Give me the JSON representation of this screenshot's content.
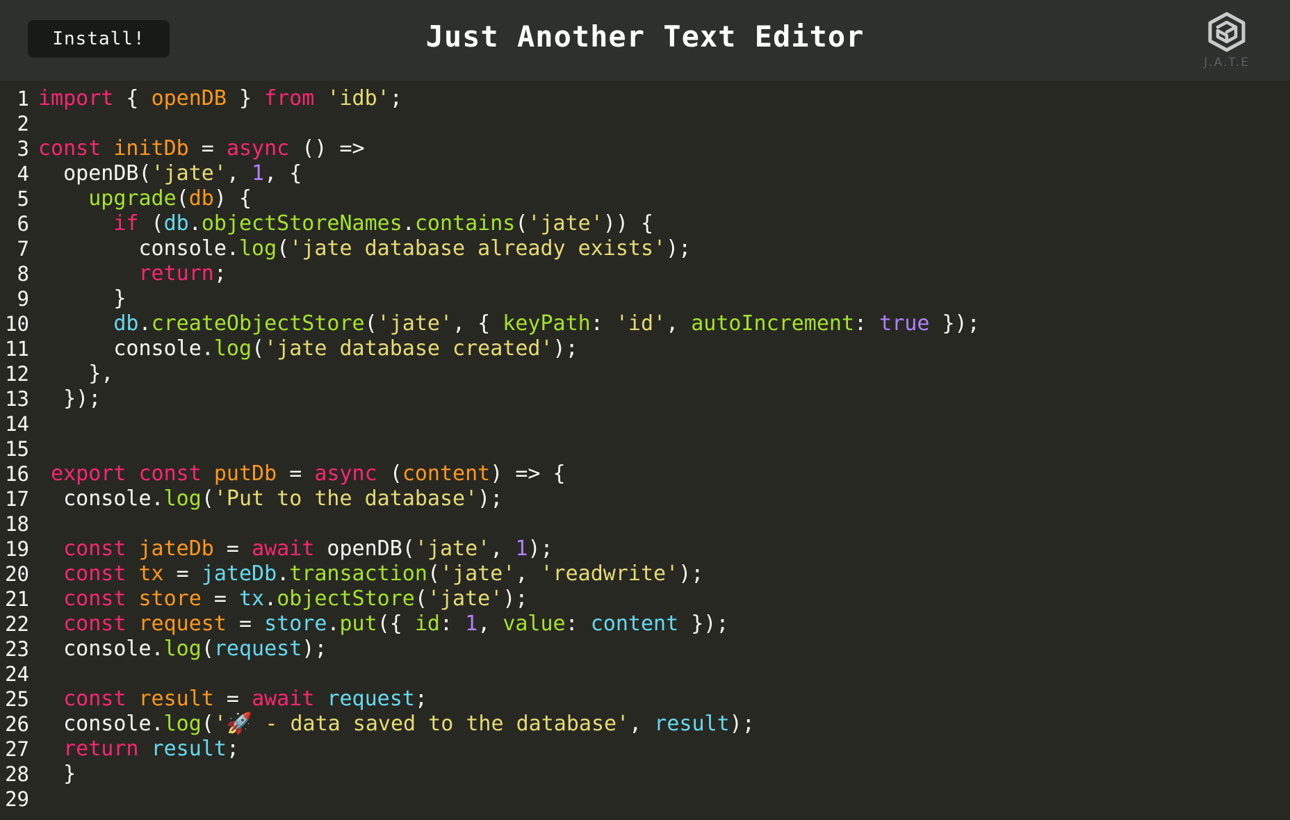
{
  "header": {
    "install_label": "Install!",
    "title": "Just Another Text Editor",
    "logo_text": "J.A.T.E"
  },
  "icons": {
    "logo": "hexagon-cube-logo-icon"
  },
  "colors": {
    "header_bg": "#2d302c",
    "editor_bg": "#272822",
    "keyword": "#f92672",
    "definition": "#fd971f",
    "string": "#e6db74",
    "number": "#ae81ff",
    "property": "#a6e22e",
    "variable": "#66d9ef"
  },
  "editor": {
    "lines": [
      [
        [
          "kw",
          "import"
        ],
        [
          "pun",
          " { "
        ],
        [
          "def",
          "openDB"
        ],
        [
          "pun",
          " } "
        ],
        [
          "kw",
          "from"
        ],
        [
          "pun",
          " "
        ],
        [
          "str",
          "'idb'"
        ],
        [
          "pun",
          ";"
        ]
      ],
      [],
      [
        [
          "kw",
          "const"
        ],
        [
          "pun",
          " "
        ],
        [
          "def",
          "initDb"
        ],
        [
          "pun",
          " = "
        ],
        [
          "kw",
          "async"
        ],
        [
          "pun",
          " () =>"
        ]
      ],
      [
        [
          "pun",
          "  openDB("
        ],
        [
          "str",
          "'jate'"
        ],
        [
          "pun",
          ", "
        ],
        [
          "num",
          "1"
        ],
        [
          "pun",
          ", {"
        ]
      ],
      [
        [
          "pun",
          "    "
        ],
        [
          "prop",
          "upgrade"
        ],
        [
          "pun",
          "("
        ],
        [
          "def",
          "db"
        ],
        [
          "pun",
          ") {"
        ]
      ],
      [
        [
          "pun",
          "      "
        ],
        [
          "kw",
          "if"
        ],
        [
          "pun",
          " ("
        ],
        [
          "var",
          "db"
        ],
        [
          "pun",
          "."
        ],
        [
          "prop",
          "objectStoreNames"
        ],
        [
          "pun",
          "."
        ],
        [
          "prop",
          "contains"
        ],
        [
          "pun",
          "("
        ],
        [
          "str",
          "'jate'"
        ],
        [
          "pun",
          ")) {"
        ]
      ],
      [
        [
          "pun",
          "        console."
        ],
        [
          "prop",
          "log"
        ],
        [
          "pun",
          "("
        ],
        [
          "str",
          "'jate database already exists'"
        ],
        [
          "pun",
          ");"
        ]
      ],
      [
        [
          "pun",
          "        "
        ],
        [
          "kw",
          "return"
        ],
        [
          "pun",
          ";"
        ]
      ],
      [
        [
          "pun",
          "      }"
        ]
      ],
      [
        [
          "pun",
          "      "
        ],
        [
          "var",
          "db"
        ],
        [
          "pun",
          "."
        ],
        [
          "prop",
          "createObjectStore"
        ],
        [
          "pun",
          "("
        ],
        [
          "str",
          "'jate'"
        ],
        [
          "pun",
          ", { "
        ],
        [
          "prop",
          "keyPath"
        ],
        [
          "pun",
          ": "
        ],
        [
          "str",
          "'id'"
        ],
        [
          "pun",
          ", "
        ],
        [
          "prop",
          "autoIncrement"
        ],
        [
          "pun",
          ": "
        ],
        [
          "num",
          "true"
        ],
        [
          "pun",
          " });"
        ]
      ],
      [
        [
          "pun",
          "      console."
        ],
        [
          "prop",
          "log"
        ],
        [
          "pun",
          "("
        ],
        [
          "str",
          "'jate database created'"
        ],
        [
          "pun",
          ");"
        ]
      ],
      [
        [
          "pun",
          "    },"
        ]
      ],
      [
        [
          "pun",
          "  });"
        ]
      ],
      [],
      [],
      [
        [
          "pun",
          " "
        ],
        [
          "kw",
          "export"
        ],
        [
          "pun",
          " "
        ],
        [
          "kw",
          "const"
        ],
        [
          "pun",
          " "
        ],
        [
          "def",
          "putDb"
        ],
        [
          "pun",
          " = "
        ],
        [
          "kw",
          "async"
        ],
        [
          "pun",
          " ("
        ],
        [
          "def",
          "content"
        ],
        [
          "pun",
          ") => {"
        ]
      ],
      [
        [
          "pun",
          "  console."
        ],
        [
          "prop",
          "log"
        ],
        [
          "pun",
          "("
        ],
        [
          "str",
          "'Put to the database'"
        ],
        [
          "pun",
          ");"
        ]
      ],
      [],
      [
        [
          "pun",
          "  "
        ],
        [
          "kw",
          "const"
        ],
        [
          "pun",
          " "
        ],
        [
          "def",
          "jateDb"
        ],
        [
          "pun",
          " = "
        ],
        [
          "kw",
          "await"
        ],
        [
          "pun",
          " openDB("
        ],
        [
          "str",
          "'jate'"
        ],
        [
          "pun",
          ", "
        ],
        [
          "num",
          "1"
        ],
        [
          "pun",
          ");"
        ]
      ],
      [
        [
          "pun",
          "  "
        ],
        [
          "kw",
          "const"
        ],
        [
          "pun",
          " "
        ],
        [
          "def",
          "tx"
        ],
        [
          "pun",
          " = "
        ],
        [
          "var",
          "jateDb"
        ],
        [
          "pun",
          "."
        ],
        [
          "prop",
          "transaction"
        ],
        [
          "pun",
          "("
        ],
        [
          "str",
          "'jate'"
        ],
        [
          "pun",
          ", "
        ],
        [
          "str",
          "'readwrite'"
        ],
        [
          "pun",
          ");"
        ]
      ],
      [
        [
          "pun",
          "  "
        ],
        [
          "kw",
          "const"
        ],
        [
          "pun",
          " "
        ],
        [
          "def",
          "store"
        ],
        [
          "pun",
          " = "
        ],
        [
          "var",
          "tx"
        ],
        [
          "pun",
          "."
        ],
        [
          "prop",
          "objectStore"
        ],
        [
          "pun",
          "("
        ],
        [
          "str",
          "'jate'"
        ],
        [
          "pun",
          ");"
        ]
      ],
      [
        [
          "pun",
          "  "
        ],
        [
          "kw",
          "const"
        ],
        [
          "pun",
          " "
        ],
        [
          "def",
          "request"
        ],
        [
          "pun",
          " = "
        ],
        [
          "var",
          "store"
        ],
        [
          "pun",
          "."
        ],
        [
          "prop",
          "put"
        ],
        [
          "pun",
          "({ "
        ],
        [
          "prop",
          "id"
        ],
        [
          "pun",
          ": "
        ],
        [
          "num",
          "1"
        ],
        [
          "pun",
          ", "
        ],
        [
          "prop",
          "value"
        ],
        [
          "pun",
          ": "
        ],
        [
          "var",
          "content"
        ],
        [
          "pun",
          " });"
        ]
      ],
      [
        [
          "pun",
          "  console."
        ],
        [
          "prop",
          "log"
        ],
        [
          "pun",
          "("
        ],
        [
          "var",
          "request"
        ],
        [
          "pun",
          ");"
        ]
      ],
      [],
      [
        [
          "pun",
          "  "
        ],
        [
          "kw",
          "const"
        ],
        [
          "pun",
          " "
        ],
        [
          "def",
          "result"
        ],
        [
          "pun",
          " = "
        ],
        [
          "kw",
          "await"
        ],
        [
          "pun",
          " "
        ],
        [
          "var",
          "request"
        ],
        [
          "pun",
          ";"
        ]
      ],
      [
        [
          "pun",
          "  console."
        ],
        [
          "prop",
          "log"
        ],
        [
          "pun",
          "("
        ],
        [
          "str",
          "'🚀 - data saved to the database'"
        ],
        [
          "pun",
          ", "
        ],
        [
          "var",
          "result"
        ],
        [
          "pun",
          ");"
        ]
      ],
      [
        [
          "pun",
          "  "
        ],
        [
          "kw",
          "return"
        ],
        [
          "pun",
          " "
        ],
        [
          "var",
          "result"
        ],
        [
          "pun",
          ";"
        ]
      ],
      [
        [
          "pun",
          "  }"
        ]
      ],
      []
    ]
  }
}
